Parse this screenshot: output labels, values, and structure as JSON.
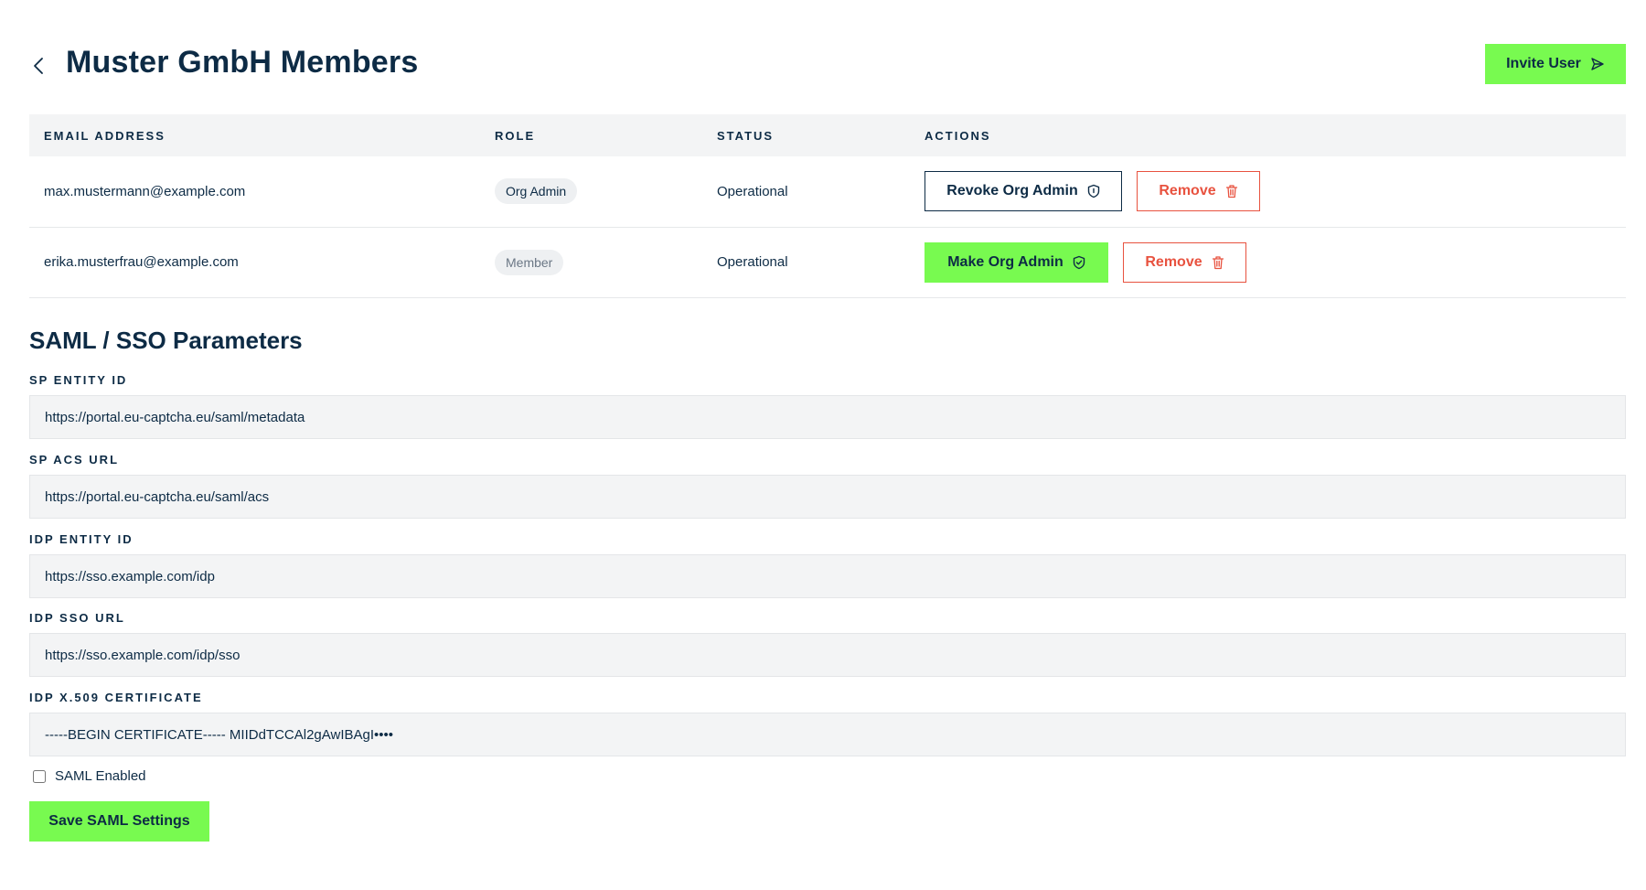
{
  "header": {
    "title": "Muster GmbH Members",
    "invite_label": "Invite User"
  },
  "table": {
    "columns": [
      "EMAIL ADDRESS",
      "ROLE",
      "STATUS",
      "ACTIONS"
    ],
    "rows": [
      {
        "email": "max.mustermann@example.com",
        "role": "Org Admin",
        "status": "Operational",
        "primary_action": "Revoke Org Admin",
        "remove_label": "Remove"
      },
      {
        "email": "erika.musterfrau@example.com",
        "role": "Member",
        "status": "Operational",
        "primary_action": "Make Org Admin",
        "remove_label": "Remove"
      }
    ]
  },
  "saml": {
    "title": "SAML / SSO Parameters",
    "fields": [
      {
        "label": "SP ENTITY ID",
        "value": "https://portal.eu-captcha.eu/saml/metadata"
      },
      {
        "label": "SP ACS URL",
        "value": "https://portal.eu-captcha.eu/saml/acs"
      },
      {
        "label": "IDP ENTITY ID",
        "value": "https://sso.example.com/idp"
      },
      {
        "label": "IDP SSO URL",
        "value": "https://sso.example.com/idp/sso"
      },
      {
        "label": "IDP X.509 CERTIFICATE",
        "value": "-----BEGIN CERTIFICATE----- MIIDdTCCAl2gAwIBAgI••••"
      }
    ],
    "enabled_label": "SAML Enabled",
    "enabled": false,
    "save_label": "Save SAML Settings"
  },
  "colors": {
    "accent_green": "#78fa50",
    "navy": "#0d2b45",
    "danger_red": "#e8523f",
    "header_bg": "#f3f4f5"
  },
  "icons": {
    "back": "chevron-left-icon",
    "invite": "send-icon",
    "revoke": "shield-icon",
    "make_admin": "shield-check-icon",
    "remove": "trash-icon"
  }
}
